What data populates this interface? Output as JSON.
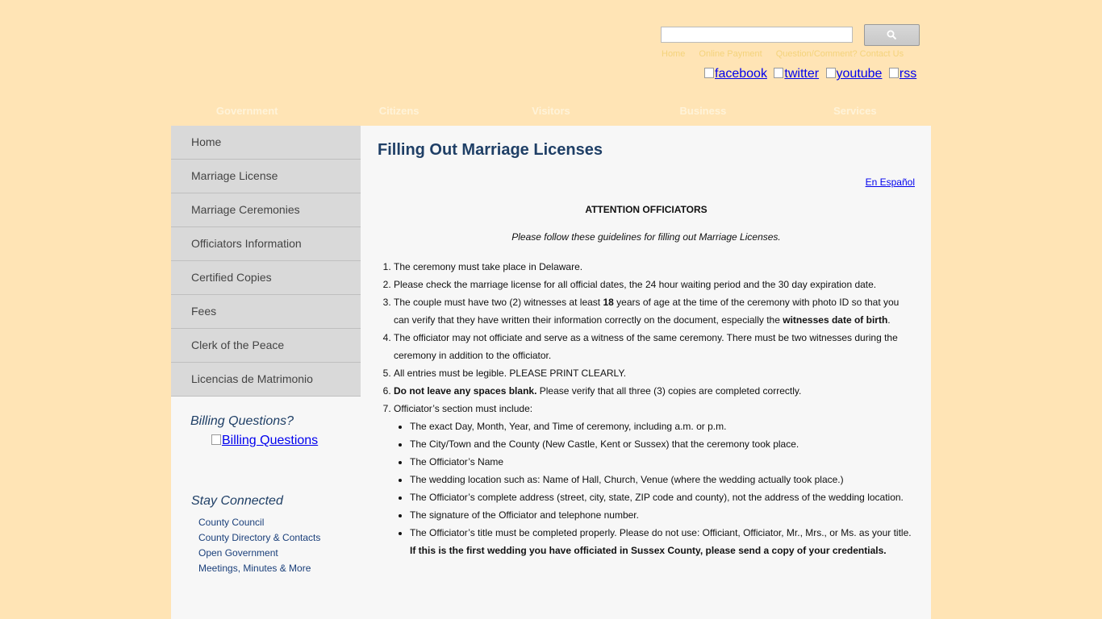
{
  "search": {
    "placeholder": ""
  },
  "top_links": [
    "Home",
    "Online Payment",
    "Question/Comment? Contact Us"
  ],
  "social": [
    "facebook",
    "twitter",
    "youtube",
    "rss"
  ],
  "main_nav": [
    "Government",
    "Citizens",
    "Visitors",
    "Business",
    "Services"
  ],
  "sidebar": {
    "items": [
      "Home",
      "Marriage License",
      "Marriage Ceremonies",
      "Officiators Information",
      "Certified Copies",
      "Fees",
      "Clerk of the Peace",
      "Licencias de Matrimonio"
    ]
  },
  "billing": {
    "title": "Billing Questions?",
    "link": "Billing Questions"
  },
  "stay_connected": {
    "title": "Stay Connected",
    "links": [
      "County Council",
      "County Directory & Contacts",
      "Open Government",
      "Meetings, Minutes & More"
    ]
  },
  "content": {
    "title": "Filling Out Marriage Licenses",
    "espanol": "En Español",
    "attention": "ATTENTION OFFICIATORS",
    "please": "Please follow these guidelines for filling out Marriage Licenses.",
    "r1": "The ceremony must take place in Delaware.",
    "r2": "Please check the marriage license for all official dates, the 24 hour waiting period and the 30 day expiration date.",
    "r3a": "The couple must have two (2) witnesses at least ",
    "r3b": "18",
    "r3c": " years of age at the time of the ceremony with photo ID so that you can verify that they have written their information correctly on the document, especially the ",
    "r3d": "witnesses date of birth",
    "r3e": ".",
    "r4": "The officiator may not officiate and serve as a witness of the same ceremony. There must be two witnesses during the ceremony in addition to the officiator.",
    "r5": "All entries must be legible. PLEASE PRINT CLEARLY.",
    "r6a": "Do not leave any spaces blank.",
    "r6b": " Please verify that all three (3) copies are completed correctly.",
    "r7": "Officiator’s section must include:",
    "s1": "The exact Day, Month, Year, and Time of ceremony, including a.m. or p.m.",
    "s2": "The City/Town and the County (New Castle, Kent or Sussex) that the ceremony took place.",
    "s3": "The Officiator’s Name",
    "s4": "The wedding location such as: Name of Hall, Church, Venue (where the wedding actually took place.)",
    "s5": "The Officiator’s complete address (street, city, state, ZIP code and county), not the address of the wedding location.",
    "s6": "The signature of the Officiator and telephone number.",
    "s7a": "The Officiator’s title must be completed properly. Please do not use: Officiant, Officiator, Mr., Mrs., or Ms. as your title. ",
    "s7b": "If this is the first wedding you have officiated in Sussex County, please send a copy of your credentials."
  }
}
